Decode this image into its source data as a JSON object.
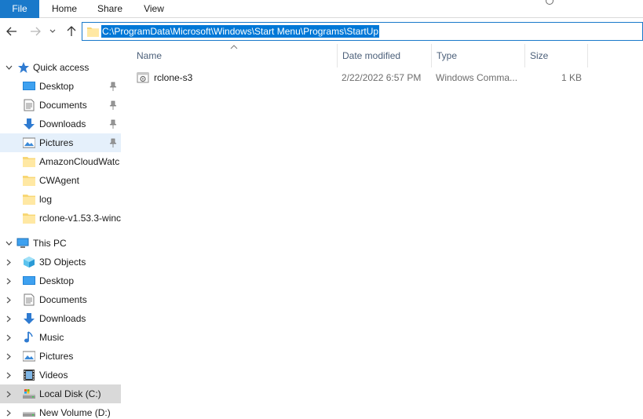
{
  "ribbon": {
    "tabs": [
      "File",
      "Home",
      "Share",
      "View"
    ]
  },
  "address": {
    "path": "C:\\ProgramData\\Microsoft\\Windows\\Start Menu\\Programs\\StartUp"
  },
  "nav": {
    "quick_access": "Quick access",
    "quick_items": [
      "Desktop",
      "Documents",
      "Downloads",
      "Pictures",
      "AmazonCloudWatc",
      "CWAgent",
      "log",
      "rclone-v1.53.3-winc"
    ],
    "this_pc": "This PC",
    "pc_items": [
      "3D Objects",
      "Desktop",
      "Documents",
      "Downloads",
      "Music",
      "Pictures",
      "Videos",
      "Local Disk (C:)",
      "New Volume (D:)"
    ]
  },
  "columns": {
    "name": "Name",
    "date": "Date modified",
    "type": "Type",
    "size": "Size"
  },
  "files": [
    {
      "name": "rclone-s3",
      "date": "2/22/2022 6:57 PM",
      "type": "Windows Comma...",
      "size": "1 KB"
    }
  ],
  "colors": {
    "accent": "#1979ca",
    "selection": "#0078d7",
    "nav_selected": "#e5f0fb",
    "header_text": "#4c607a"
  }
}
